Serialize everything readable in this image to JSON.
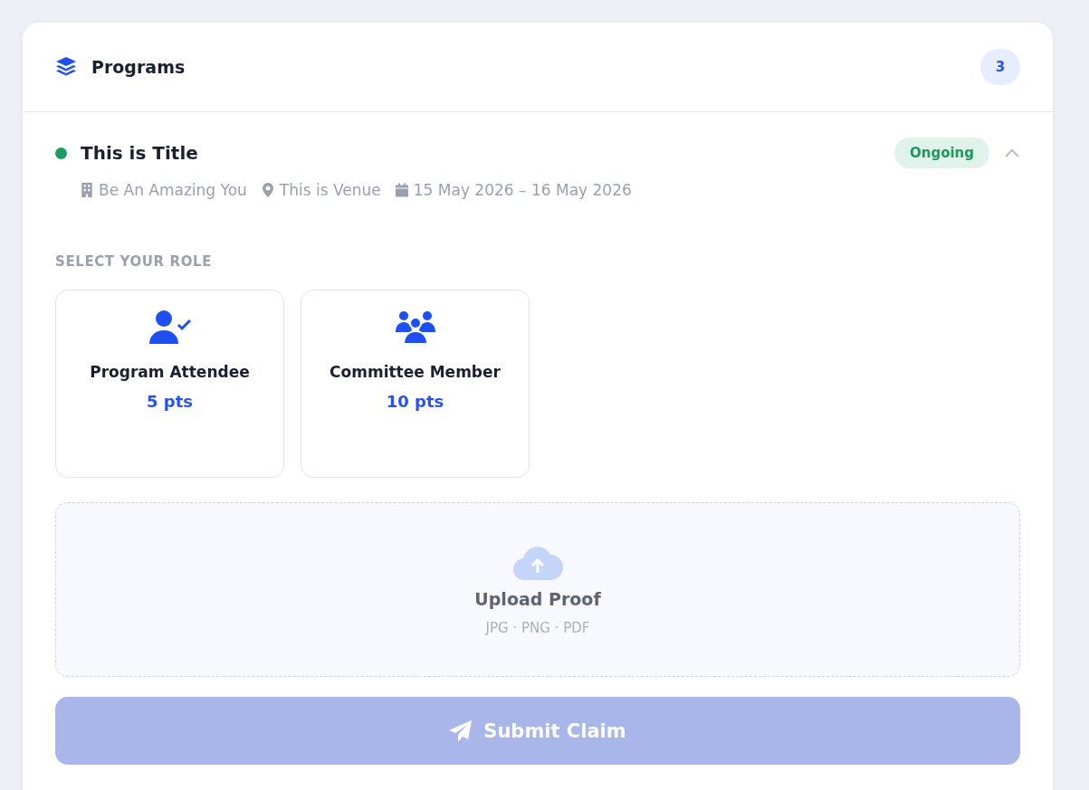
{
  "panel": {
    "title": "Programs",
    "count": "3"
  },
  "program": {
    "color": "#1a9e5f",
    "title": "This is Title",
    "status": "Ongoing",
    "expanded": true,
    "meta": [
      {
        "kind": "organizer",
        "text": "Be An Amazing You"
      },
      {
        "kind": "venue",
        "text": "This is Venue"
      },
      {
        "kind": "date",
        "text": "15 May 2026 – 16 May 2026"
      }
    ],
    "role_label": "SELECT YOUR ROLE",
    "roles": [
      {
        "kind": "attendee",
        "name": "Program Attendee",
        "points": "5 pts",
        "selected": false
      },
      {
        "kind": "committee",
        "name": "Committee Member",
        "points": "10 pts",
        "selected": false
      }
    ],
    "upload": {
      "title": "Upload Proof",
      "formats": "JPG · PNG · PDF"
    },
    "submit": {
      "label": "Submit Claim",
      "disabled": true
    }
  }
}
